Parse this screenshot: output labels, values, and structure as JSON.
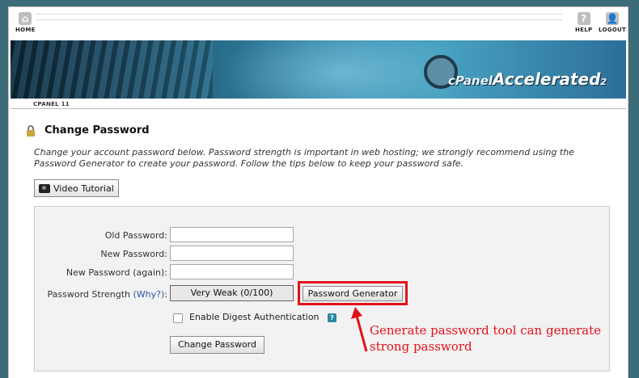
{
  "topnav": {
    "home_label": "HOME",
    "help_label": "HELP",
    "logout_label": "LOGOUT"
  },
  "banner": {
    "logo_cp": "cPanel",
    "logo_accel": "Accelerated",
    "logo_version": "2"
  },
  "breadcrumb": {
    "tab_label": "CPANEL 11"
  },
  "page": {
    "title": "Change Password",
    "description": "Change your account password below. Password strength is important in web hosting; we strongly recommend using the Password Generator to create your password. Follow the tips below to keep your password safe.",
    "video_tutorial_label": "Video Tutorial"
  },
  "form": {
    "old_password_label": "Old Password:",
    "new_password_label": "New Password:",
    "new_password_again_label": "New Password (again):",
    "strength_label": "Password Strength",
    "strength_why": "(Why?)",
    "strength_colon": ":",
    "strength_value": "Very Weak (0/100)",
    "generator_button": "Password Generator",
    "digest_label": "Enable Digest Authentication",
    "submit_button": "Change Password"
  },
  "annotation": {
    "text": "Generate password tool can generate strong password"
  },
  "colors": {
    "highlight": "#e3111a",
    "link": "#2a56a4"
  },
  "icons": [
    "home-icon",
    "help-icon",
    "logout-icon",
    "lock-icon",
    "camera-icon",
    "info-icon",
    "arrow-icon"
  ]
}
